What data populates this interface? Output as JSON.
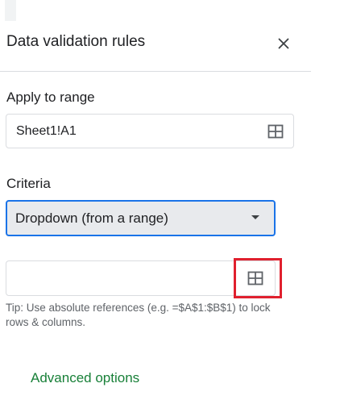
{
  "panel": {
    "title": "Data validation rules",
    "close_icon": "close-icon"
  },
  "apply_to_range": {
    "label": "Apply to range",
    "value": "Sheet1!A1",
    "icon": "select-range-icon"
  },
  "criteria": {
    "label": "Criteria",
    "selected": "Dropdown (from a range)",
    "icon": "dropdown-caret-icon"
  },
  "range_source": {
    "value": "",
    "placeholder": "",
    "icon": "select-range-icon",
    "tip": "Tip: Use absolute references (e.g. =$A$1:$B$1) to lock rows & columns."
  },
  "advanced_options": {
    "label": "Advanced options"
  },
  "colors": {
    "accent_blue": "#1a73e8",
    "link_green": "#188038",
    "highlight_red": "#e0202e"
  }
}
